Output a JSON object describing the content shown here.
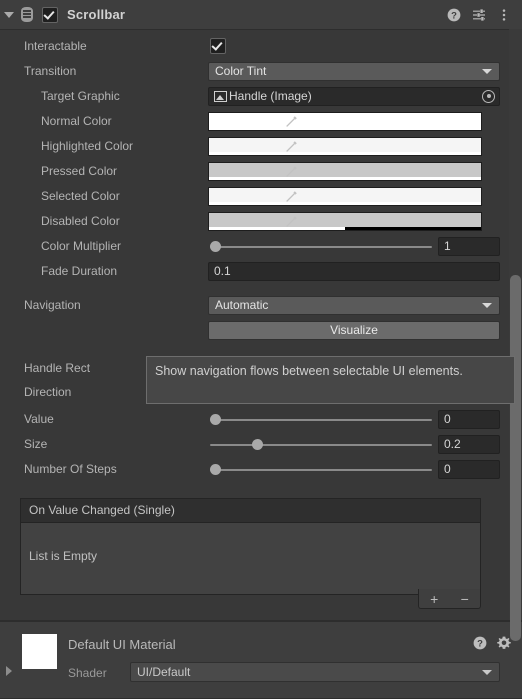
{
  "header": {
    "title": "Scrollbar",
    "enabled": true,
    "foldout_icon": "foldout-triangle-icon",
    "script_icon": "component-script-icon",
    "help_icon": "help-icon",
    "preset_icon": "preset-icon",
    "menu_icon": "more-menu-icon"
  },
  "properties": {
    "interactable": {
      "label": "Interactable",
      "checked": true
    },
    "transition": {
      "label": "Transition",
      "value": "Color Tint"
    },
    "target_graphic": {
      "label": "Target Graphic",
      "value": "Handle (Image)"
    },
    "normal_color": {
      "label": "Normal Color",
      "value": "#FFFFFF",
      "alpha_pct": 100
    },
    "highlighted_color": {
      "label": "Highlighted Color",
      "value": "#F5F5F5",
      "alpha_pct": 100
    },
    "pressed_color": {
      "label": "Pressed Color",
      "value": "#C8C8C8",
      "alpha_pct": 100
    },
    "selected_color": {
      "label": "Selected Color",
      "value": "#F5F5F5",
      "alpha_pct": 100
    },
    "disabled_color": {
      "label": "Disabled Color",
      "value": "#C8C8C8",
      "alpha_pct": 50
    },
    "color_multiplier": {
      "label": "Color Multiplier",
      "value": "1",
      "knob_pct": 0
    },
    "fade_duration": {
      "label": "Fade Duration",
      "value": "0.1"
    },
    "navigation": {
      "label": "Navigation",
      "value": "Automatic"
    },
    "visualize": {
      "label": "Visualize"
    },
    "handle_rect": {
      "label": "Handle Rect"
    },
    "direction": {
      "label": "Direction"
    },
    "value": {
      "label": "Value",
      "value": "0",
      "knob_pct": 0
    },
    "size": {
      "label": "Size",
      "value": "0.2",
      "knob_pct": 20
    },
    "number_of_steps": {
      "label": "Number Of Steps",
      "value": "0",
      "knob_pct": 0
    }
  },
  "tooltip": {
    "text": "Show navigation flows between selectable UI elements."
  },
  "event_list": {
    "header": "On Value Changed (Single)",
    "empty_text": "List is Empty",
    "add_label": "+",
    "remove_label": "−"
  },
  "material": {
    "title": "Default UI Material",
    "swatch_color": "#FFFFFF",
    "shader_label": "Shader",
    "shader_value": "UI/Default",
    "help_icon": "help-icon",
    "settings_icon": "gear-icon",
    "expand_icon": "expand-arrow-icon"
  },
  "colors": {
    "background": "#383838",
    "header_bg": "#3E3E3E",
    "field_bg": "#2A2A2A",
    "dropdown_bg": "#5A5A5A",
    "text": "#B4B4B4"
  }
}
